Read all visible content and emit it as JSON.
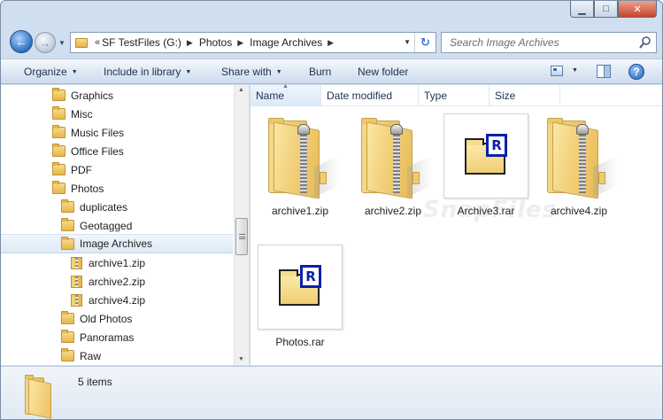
{
  "window": {
    "caption_buttons": {
      "minimize": "▁",
      "maximize": "□",
      "close": "✕"
    }
  },
  "nav": {
    "back_icon": "back-arrow-icon",
    "forward_icon": "forward-arrow-icon"
  },
  "address": {
    "overflow": "«",
    "crumbs": [
      "SF TestFiles (G:)",
      "Photos",
      "Image Archives"
    ],
    "separator": "▶",
    "dropdown": "▼",
    "refresh": "↻"
  },
  "search": {
    "placeholder": "Search Image Archives"
  },
  "toolbar": {
    "organize": "Organize",
    "include_in_library": "Include in library",
    "share_with": "Share with",
    "burn": "Burn",
    "new_folder": "New folder",
    "help": "?",
    "dropdown_arrow": "▼"
  },
  "tree": {
    "items": [
      {
        "label": "Graphics",
        "type": "folder",
        "level": 1
      },
      {
        "label": "Misc",
        "type": "folder",
        "level": 1
      },
      {
        "label": "Music Files",
        "type": "folder",
        "level": 1
      },
      {
        "label": "Office Files",
        "type": "folder",
        "level": 1
      },
      {
        "label": "PDF",
        "type": "folder",
        "level": 1
      },
      {
        "label": "Photos",
        "type": "folder",
        "level": 1
      },
      {
        "label": "duplicates",
        "type": "folder",
        "level": 2
      },
      {
        "label": "Geotagged",
        "type": "folder",
        "level": 2
      },
      {
        "label": "Image Archives",
        "type": "folder",
        "level": 2,
        "selected": true
      },
      {
        "label": "archive1.zip",
        "type": "zip",
        "level": 3
      },
      {
        "label": "archive2.zip",
        "type": "zip",
        "level": 3
      },
      {
        "label": "archive4.zip",
        "type": "zip",
        "level": 3
      },
      {
        "label": "Old Photos",
        "type": "folder",
        "level": 2
      },
      {
        "label": "Panoramas",
        "type": "folder",
        "level": 2
      },
      {
        "label": "Raw",
        "type": "folder",
        "level": 2
      }
    ]
  },
  "columns": {
    "name": "Name",
    "date_modified": "Date modified",
    "type": "Type",
    "size": "Size",
    "sort_indicator": "▲"
  },
  "files": [
    {
      "name": "archive1.zip",
      "kind": "zip"
    },
    {
      "name": "archive2.zip",
      "kind": "zip"
    },
    {
      "name": "Archive3.rar",
      "kind": "rar"
    },
    {
      "name": "archive4.zip",
      "kind": "zip"
    },
    {
      "name": "Photos.rar",
      "kind": "rar"
    }
  ],
  "rar_badge_letter": "R",
  "watermark": "SnapFiles",
  "details": {
    "item_count": "5 items"
  },
  "colors": {
    "selection": "#dde9f5",
    "accent": "#0b1fae",
    "folder": "#f0cf74"
  }
}
